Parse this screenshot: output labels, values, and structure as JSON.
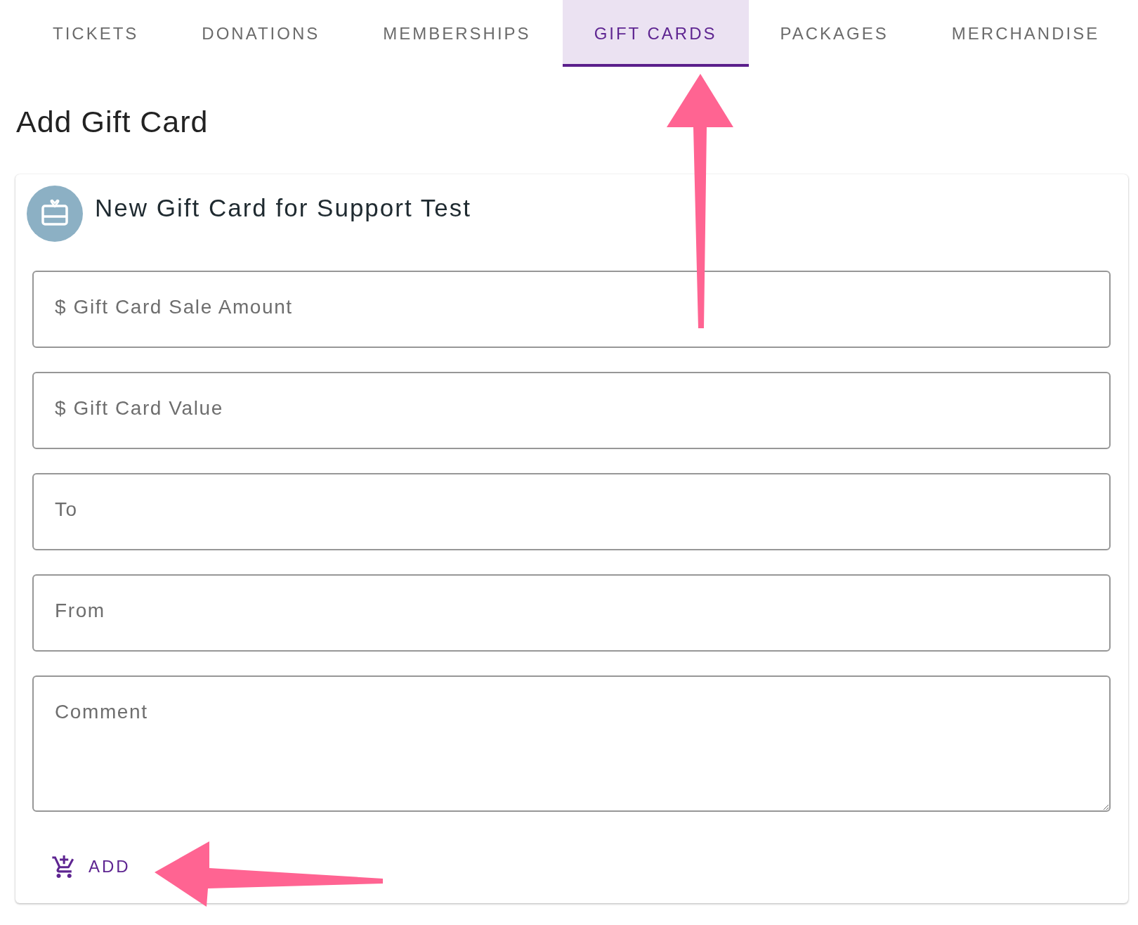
{
  "tabs": [
    {
      "label": "TICKETS",
      "selected": false
    },
    {
      "label": "DONATIONS",
      "selected": false
    },
    {
      "label": "MEMBERSHIPS",
      "selected": false
    },
    {
      "label": "GIFT CARDS",
      "selected": true
    },
    {
      "label": "PACKAGES",
      "selected": false
    },
    {
      "label": "MERCHANDISE",
      "selected": false
    }
  ],
  "heading": "Add Gift Card",
  "card": {
    "title": "New Gift Card for Support Test",
    "fields": [
      {
        "kind": "input",
        "placeholder": "$ Gift Card Sale Amount"
      },
      {
        "kind": "input",
        "placeholder": "$ Gift Card Value"
      },
      {
        "kind": "input",
        "placeholder": "To"
      },
      {
        "kind": "input",
        "placeholder": "From"
      },
      {
        "kind": "textarea",
        "placeholder": "Comment"
      }
    ],
    "add_button": {
      "label": "ADD"
    }
  }
}
